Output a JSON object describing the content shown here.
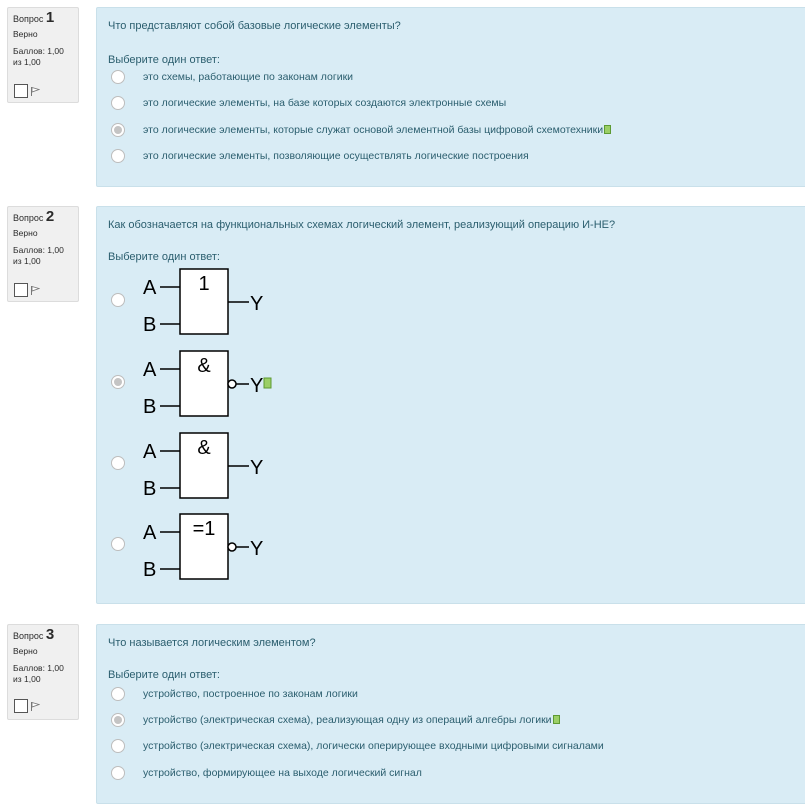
{
  "questions": [
    {
      "label": "Вопрос",
      "number": "1",
      "state": "Верно",
      "grade": "Баллов: 1,00 из 1,00",
      "text": "Что представляют собой базовые логические элементы?",
      "prompt": "Выберите один ответ:",
      "answers": [
        {
          "text": "это схемы, работающие по законам логики",
          "selected": false
        },
        {
          "text": "это логические элементы, на базе которых создаются электронные схемы",
          "selected": false
        },
        {
          "text": "это логические элементы, которые служат основой элементной базы цифровой схемотехники",
          "selected": true
        },
        {
          "text": "это логические элементы, позволяющие осуществлять логические построения",
          "selected": false
        }
      ]
    },
    {
      "label": "Вопрос",
      "number": "2",
      "state": "Верно",
      "grade": "Баллов: 1,00 из 1,00",
      "text": "Как обозначается на функциональных схемах логический элемент, реализующий операцию И-НЕ?",
      "prompt": "Выберите один ответ:",
      "answers": [
        {
          "symbol": "1",
          "in_a": "A",
          "in_b": "B",
          "out": "Y",
          "inverted": false,
          "selected": false
        },
        {
          "symbol": "&",
          "in_a": "A",
          "in_b": "B",
          "out": "Y",
          "inverted": true,
          "selected": true
        },
        {
          "symbol": "&",
          "in_a": "A",
          "in_b": "B",
          "out": "Y",
          "inverted": false,
          "selected": false
        },
        {
          "symbol": "=1",
          "in_a": "A",
          "in_b": "B",
          "out": "Y",
          "inverted": true,
          "selected": false
        }
      ]
    },
    {
      "label": "Вопрос",
      "number": "3",
      "state": "Верно",
      "grade": "Баллов: 1,00 из 1,00",
      "text": "Что называется логическим элементом?",
      "prompt": "Выберите один ответ:",
      "answers": [
        {
          "text": "устройство, построенное по законам логики",
          "selected": false
        },
        {
          "text": "устройство (электрическая схема), реализующая одну из операций алгебры логики",
          "selected": true
        },
        {
          "text": "устройство (электрическая схема), логически оперирующее входными цифровыми сигналами",
          "selected": false
        },
        {
          "text": "устройство, формирующее на выходе логический сигнал",
          "selected": false
        }
      ]
    }
  ],
  "icons": {
    "flag": "flag-icon",
    "correct_mark": "correct-check-icon"
  },
  "colors": {
    "content_bg": "#d9ecf5",
    "info_bg": "#f0f0f0",
    "text": "#2b5e6e",
    "correct": "#9bcf66"
  }
}
